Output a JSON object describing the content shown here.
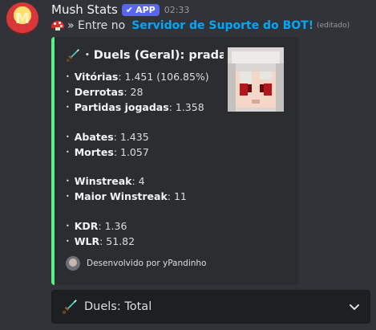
{
  "message": {
    "author": "Mush Stats",
    "badge": "APP",
    "time": "02:33",
    "intro": "»  Entre no",
    "link_text": "Servidor de Suporte do BOT!",
    "edited": "(editado)"
  },
  "embed": {
    "accent_color": "#57f287",
    "title": "Duels (Geral): pradaa",
    "stats": [
      {
        "label": "Vitórias",
        "value": ": 1.451 (106.85%)"
      },
      {
        "label": "Derrotas",
        "value": ": 28"
      },
      {
        "label": "Partidas jogadas",
        "value": ": 1.358"
      },
      {
        "label": "Abates",
        "value": ": 1.435"
      },
      {
        "label": "Mortes",
        "value": ": 1.057"
      },
      {
        "label": "Winstreak",
        "value": ": 4"
      },
      {
        "label": "Maior Winstreak",
        "value": ": 11"
      },
      {
        "label": "KDR",
        "value": ": 1.36"
      },
      {
        "label": "WLR",
        "value": ": 51.82"
      }
    ],
    "footer": "Desenvolvido por yPandinho"
  },
  "select": {
    "value": "Duels: Total",
    "icon": "sword-icon"
  },
  "colors": {
    "background": "#313338",
    "embed_bg": "#2b2d31",
    "link": "#00a8fc",
    "badge": "#5865f2"
  }
}
